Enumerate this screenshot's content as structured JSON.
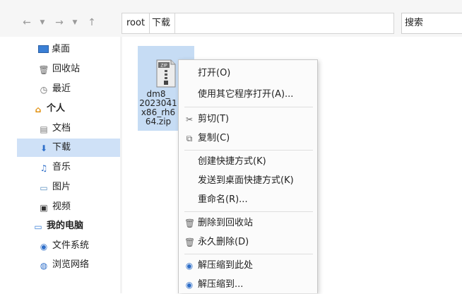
{
  "toolbar": {
    "back_icon": "back-arrow-icon",
    "forward_icon": "forward-arrow-icon",
    "up_icon": "up-arrow-icon",
    "breadcrumbs": [
      "root",
      "下载"
    ],
    "search_label": "搜索"
  },
  "sidebar": {
    "items": [
      {
        "label": "桌面",
        "icon": "desktop-icon"
      },
      {
        "label": "回收站",
        "icon": "trash-icon"
      },
      {
        "label": "最近",
        "icon": "clock-icon"
      },
      {
        "label": "个人",
        "icon": "home-icon"
      },
      {
        "label": "文档",
        "icon": "document-icon"
      },
      {
        "label": "下载",
        "icon": "download-icon"
      },
      {
        "label": "音乐",
        "icon": "music-icon"
      },
      {
        "label": "图片",
        "icon": "picture-icon"
      },
      {
        "label": "视频",
        "icon": "video-icon"
      },
      {
        "label": "我的电脑",
        "icon": "computer-icon"
      },
      {
        "label": "文件系统",
        "icon": "disk-icon"
      },
      {
        "label": "浏览网络",
        "icon": "network-icon"
      }
    ],
    "selected": "下载"
  },
  "file": {
    "icon_text": "ZIP",
    "name_lines": [
      "dm8_",
      "2023041",
      "x86_rh6",
      "64.zip"
    ]
  },
  "context_menu": {
    "items": [
      {
        "label": "打开(O)",
        "icon": ""
      },
      {
        "label": "使用其它程序打开(A)...",
        "icon": ""
      },
      {
        "label": "剪切(T)",
        "icon": "scissors-icon"
      },
      {
        "label": "复制(C)",
        "icon": "copy-icon"
      },
      {
        "label": "创建快捷方式(K)",
        "icon": ""
      },
      {
        "label": "发送到桌面快捷方式(K)",
        "icon": ""
      },
      {
        "label": "重命名(R)...",
        "icon": ""
      },
      {
        "label": "删除到回收站",
        "icon": "trash-icon"
      },
      {
        "label": "永久删除(D)",
        "icon": "delete-icon"
      },
      {
        "label": "解压缩到此处",
        "icon": "extract-icon"
      },
      {
        "label": "解压缩到...",
        "icon": "extract-to-icon"
      }
    ]
  }
}
